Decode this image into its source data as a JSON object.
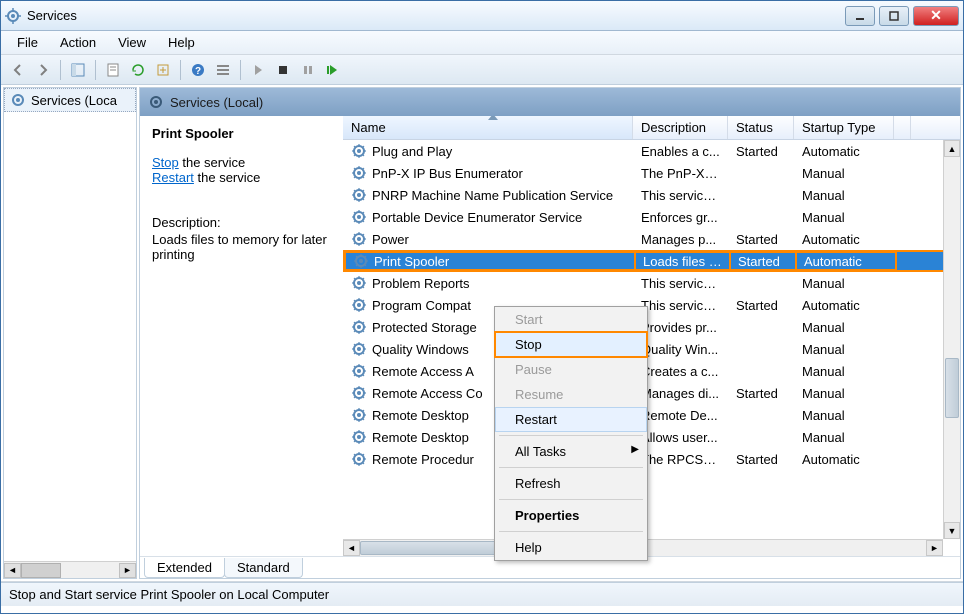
{
  "window": {
    "title": "Services"
  },
  "menu": {
    "file": "File",
    "action": "Action",
    "view": "View",
    "help": "Help"
  },
  "tree": {
    "root": "Services (Loca"
  },
  "pane": {
    "title": "Services (Local)"
  },
  "detail": {
    "name": "Print Spooler",
    "stop_link": "Stop",
    "stop_suffix": " the service",
    "restart_link": "Restart",
    "restart_suffix": " the service",
    "desc_label": "Description:",
    "desc_text": "Loads files to memory for later printing"
  },
  "columns": {
    "name": "Name",
    "desc": "Description",
    "status": "Status",
    "startup": "Startup Type"
  },
  "rows": [
    {
      "name": "Plug and Play",
      "desc": "Enables a c...",
      "status": "Started",
      "startup": "Automatic"
    },
    {
      "name": "PnP-X IP Bus Enumerator",
      "desc": "The PnP-X b...",
      "status": "",
      "startup": "Manual"
    },
    {
      "name": "PNRP Machine Name Publication Service",
      "desc": "This service ...",
      "status": "",
      "startup": "Manual"
    },
    {
      "name": "Portable Device Enumerator Service",
      "desc": "Enforces gr...",
      "status": "",
      "startup": "Manual"
    },
    {
      "name": "Power",
      "desc": "Manages p...",
      "status": "Started",
      "startup": "Automatic"
    },
    {
      "name": "Print Spooler",
      "desc": "Loads files t...",
      "status": "Started",
      "startup": "Automatic"
    },
    {
      "name": "Problem Reports",
      "desc": "This service ...",
      "status": "",
      "startup": "Manual"
    },
    {
      "name": "Program Compat",
      "desc": "This service ...",
      "status": "Started",
      "startup": "Automatic"
    },
    {
      "name": "Protected Storage",
      "desc": "Provides pr...",
      "status": "",
      "startup": "Manual"
    },
    {
      "name": "Quality Windows",
      "desc": "Quality Win...",
      "status": "",
      "startup": "Manual"
    },
    {
      "name": "Remote Access A",
      "desc": "Creates a c...",
      "status": "",
      "startup": "Manual"
    },
    {
      "name": "Remote Access Co",
      "desc": "Manages di...",
      "status": "Started",
      "startup": "Manual"
    },
    {
      "name": "Remote Desktop",
      "desc": "Remote De...",
      "status": "",
      "startup": "Manual"
    },
    {
      "name": "Remote Desktop",
      "desc": "Allows user...",
      "status": "",
      "startup": "Manual"
    },
    {
      "name": "Remote Procedur",
      "desc": "The RPCSS s...",
      "status": "Started",
      "startup": "Automatic"
    }
  ],
  "selected_index": 5,
  "tabs": {
    "extended": "Extended",
    "standard": "Standard"
  },
  "status_text": "Stop and Start service Print Spooler on Local Computer",
  "context_menu": {
    "start": "Start",
    "stop": "Stop",
    "pause": "Pause",
    "resume": "Resume",
    "restart": "Restart",
    "all_tasks": "All Tasks",
    "refresh": "Refresh",
    "properties": "Properties",
    "help": "Help"
  }
}
